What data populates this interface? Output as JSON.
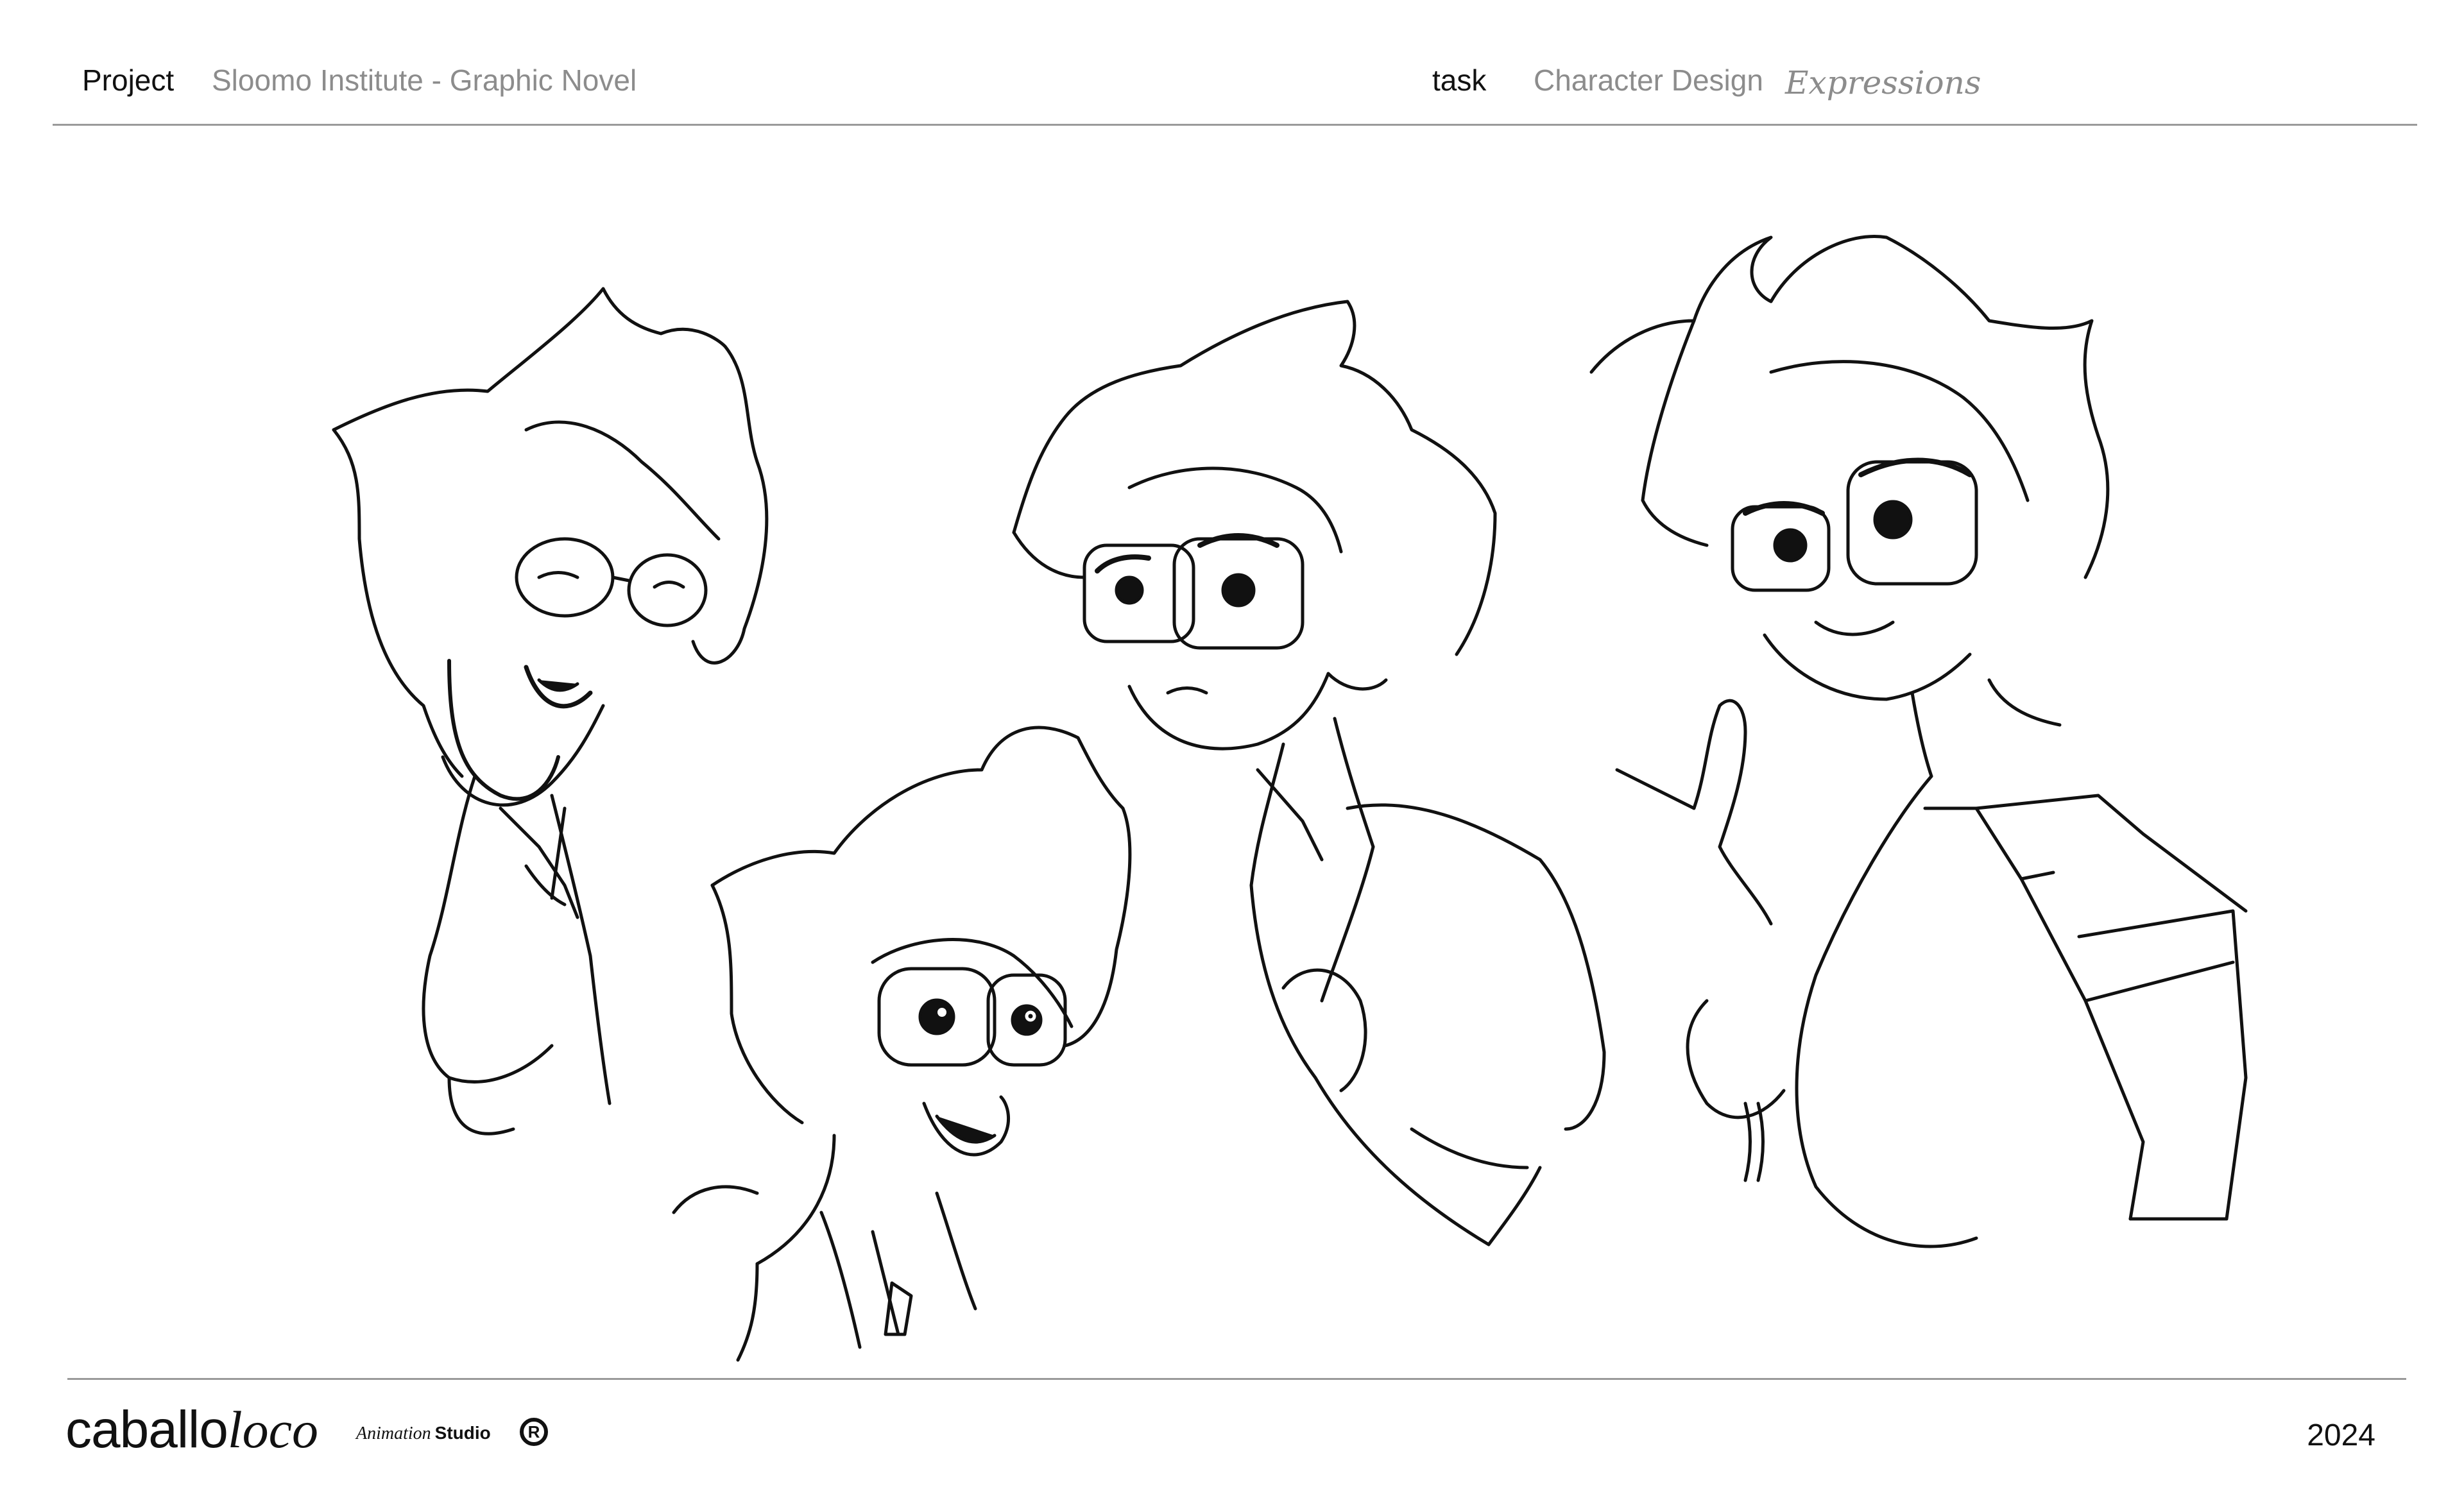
{
  "header": {
    "project_label": "Project",
    "project_value": "Sloomo Institute - Graphic Novel",
    "task_label": "task",
    "task_value": "Character Design",
    "task_note": "Expressions"
  },
  "footer": {
    "brand_main": "caballo",
    "brand_italic": "loco",
    "brand_sub_italic": "Animation",
    "brand_sub_bold": "Studio",
    "registered_mark": "R",
    "year": "2024"
  },
  "artwork": {
    "line_color": "#111111",
    "sketches": [
      "laughing-pose",
      "surprised-pose",
      "grumpy-pose",
      "confident-thumb-pose"
    ]
  }
}
